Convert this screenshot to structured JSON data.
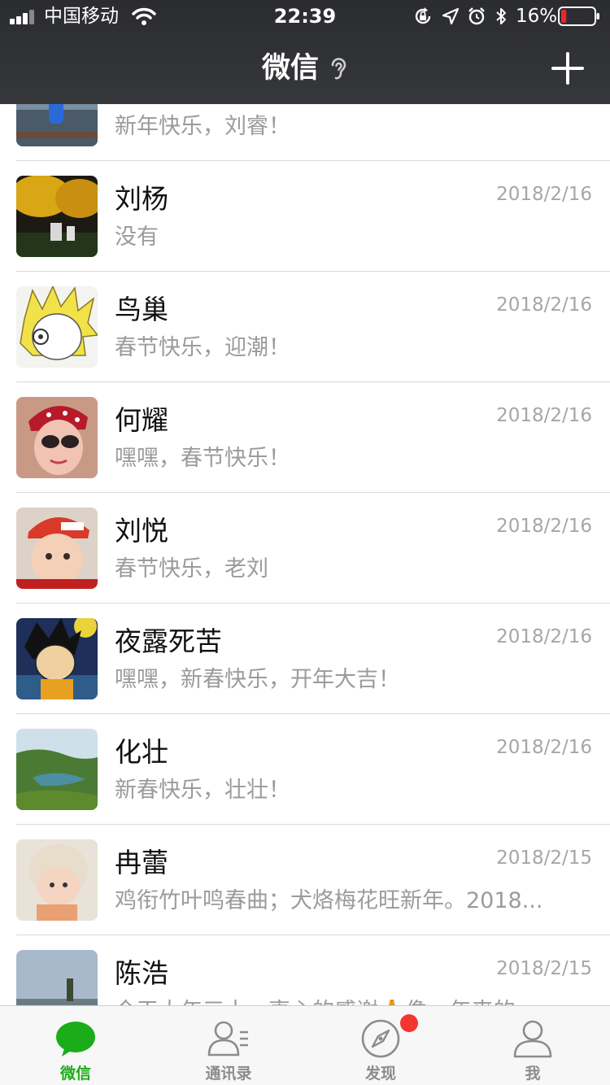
{
  "status_bar": {
    "carrier": "中国移动",
    "time": "22:39",
    "battery_percent": "16%",
    "battery_level": 0.16,
    "icons": [
      "signal-icon",
      "wifi-icon",
      "orientation-lock-icon",
      "location-icon",
      "alarm-icon",
      "bluetooth-icon",
      "battery-icon"
    ]
  },
  "nav": {
    "title": "微信",
    "title_icon": "ear-icon",
    "action_icon": "plus-icon"
  },
  "chats": [
    {
      "name": "",
      "preview": "新年快乐，刘睿！",
      "date": "",
      "avatar_icon": "avatar-photo"
    },
    {
      "name": "刘杨",
      "preview": "没有",
      "date": "2018/2/16",
      "avatar_icon": "avatar-photo"
    },
    {
      "name": "鸟巢",
      "preview": "春节快乐，迎潮！",
      "date": "2018/2/16",
      "avatar_icon": "avatar-cartoon"
    },
    {
      "name": "何耀",
      "preview": "嘿嘿，春节快乐！",
      "date": "2018/2/16",
      "avatar_icon": "avatar-photo"
    },
    {
      "name": "刘悦",
      "preview": "春节快乐，老刘",
      "date": "2018/2/16",
      "avatar_icon": "avatar-photo"
    },
    {
      "name": "夜露死苦",
      "preview": "嘿嘿，新春快乐，开年大吉！",
      "date": "2018/2/16",
      "avatar_icon": "avatar-cartoon"
    },
    {
      "name": "化壮",
      "preview": "新春快乐，壮壮！",
      "date": "2018/2/16",
      "avatar_icon": "avatar-landscape"
    },
    {
      "name": "冉蕾",
      "preview": "鸡衔竹叶鸣春曲；犬烙梅花旺新年。2018...",
      "date": "2018/2/15",
      "avatar_icon": "avatar-photo"
    },
    {
      "name": "陈浩",
      "preview": "今天大年三十，衷心的感谢🙏像一年来的...",
      "date": "2018/2/15",
      "avatar_icon": "avatar-landscape"
    }
  ],
  "tabs": [
    {
      "label": "微信",
      "icon": "chat-bubble-icon",
      "active": true
    },
    {
      "label": "通讯录",
      "icon": "contacts-icon",
      "active": false
    },
    {
      "label": "发现",
      "icon": "compass-icon",
      "active": false,
      "badge": true
    },
    {
      "label": "我",
      "icon": "person-icon",
      "active": false
    }
  ],
  "colors": {
    "nav_background": "#2e2f33",
    "accent_green": "#1aad19",
    "badge_red": "#f43530",
    "battery_low_red": "#e8272b"
  }
}
